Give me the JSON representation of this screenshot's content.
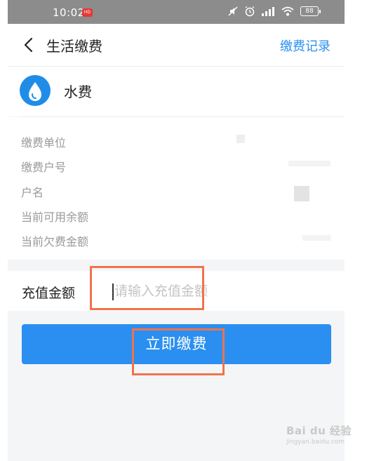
{
  "status_bar": {
    "time": "10:02",
    "badge_text": "HD",
    "battery": "88"
  },
  "header": {
    "title": "生活缴费",
    "history_link": "缴费记录"
  },
  "biller": {
    "name": "水费",
    "icon": "water-drop-icon"
  },
  "info_labels": [
    "缴费单位",
    "缴费户号",
    "户名",
    "当前可用余额",
    "当前欠费金额"
  ],
  "amount": {
    "label": "充值金额",
    "placeholder": "请输入充值金额",
    "value": ""
  },
  "pay_button": {
    "label": "立即缴费"
  },
  "watermark": {
    "main": "Bai du 经验",
    "sub": "jingyan.baidu.com"
  },
  "colors": {
    "accent": "#2a8ff0",
    "highlight": "#f0734c",
    "status_bar": "#8c8c8c"
  }
}
